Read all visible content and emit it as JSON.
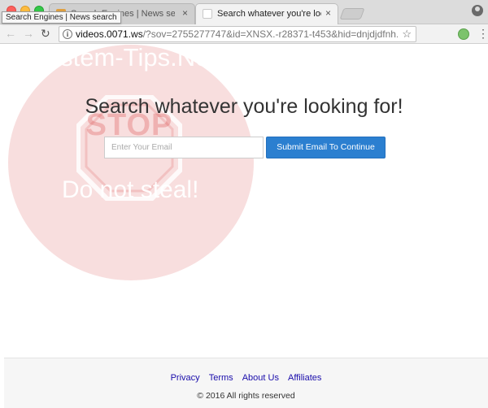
{
  "browser": {
    "tabs": [
      {
        "title": "Search Engines | News search",
        "active": false
      },
      {
        "title": "Search whatever you're looking for!",
        "active": true
      }
    ],
    "tooltip": "Search Engines | News search",
    "close_glyph": "×",
    "url": {
      "host": "videos.0071.ws",
      "path": "/?sov=2755277747&id=XNSX.-r28371-t453&hid=dnjdjdfnh..."
    }
  },
  "watermark": {
    "top_text": "System-Tips.Net",
    "stop_text": "STOP",
    "bottom_text": "Do not steal!"
  },
  "main": {
    "headline": "Search whatever you're looking for!",
    "email_placeholder": "Enter Your Email",
    "email_value": "",
    "submit_label": "Submit Email To Continue"
  },
  "footer": {
    "links": [
      "Privacy",
      "Terms",
      "About Us",
      "Affiliates"
    ],
    "copyright": "© 2016 All rights reserved"
  },
  "colors": {
    "button": "#2b7fd0",
    "link": "#1a0dab",
    "watermark": "#d63c3c"
  }
}
